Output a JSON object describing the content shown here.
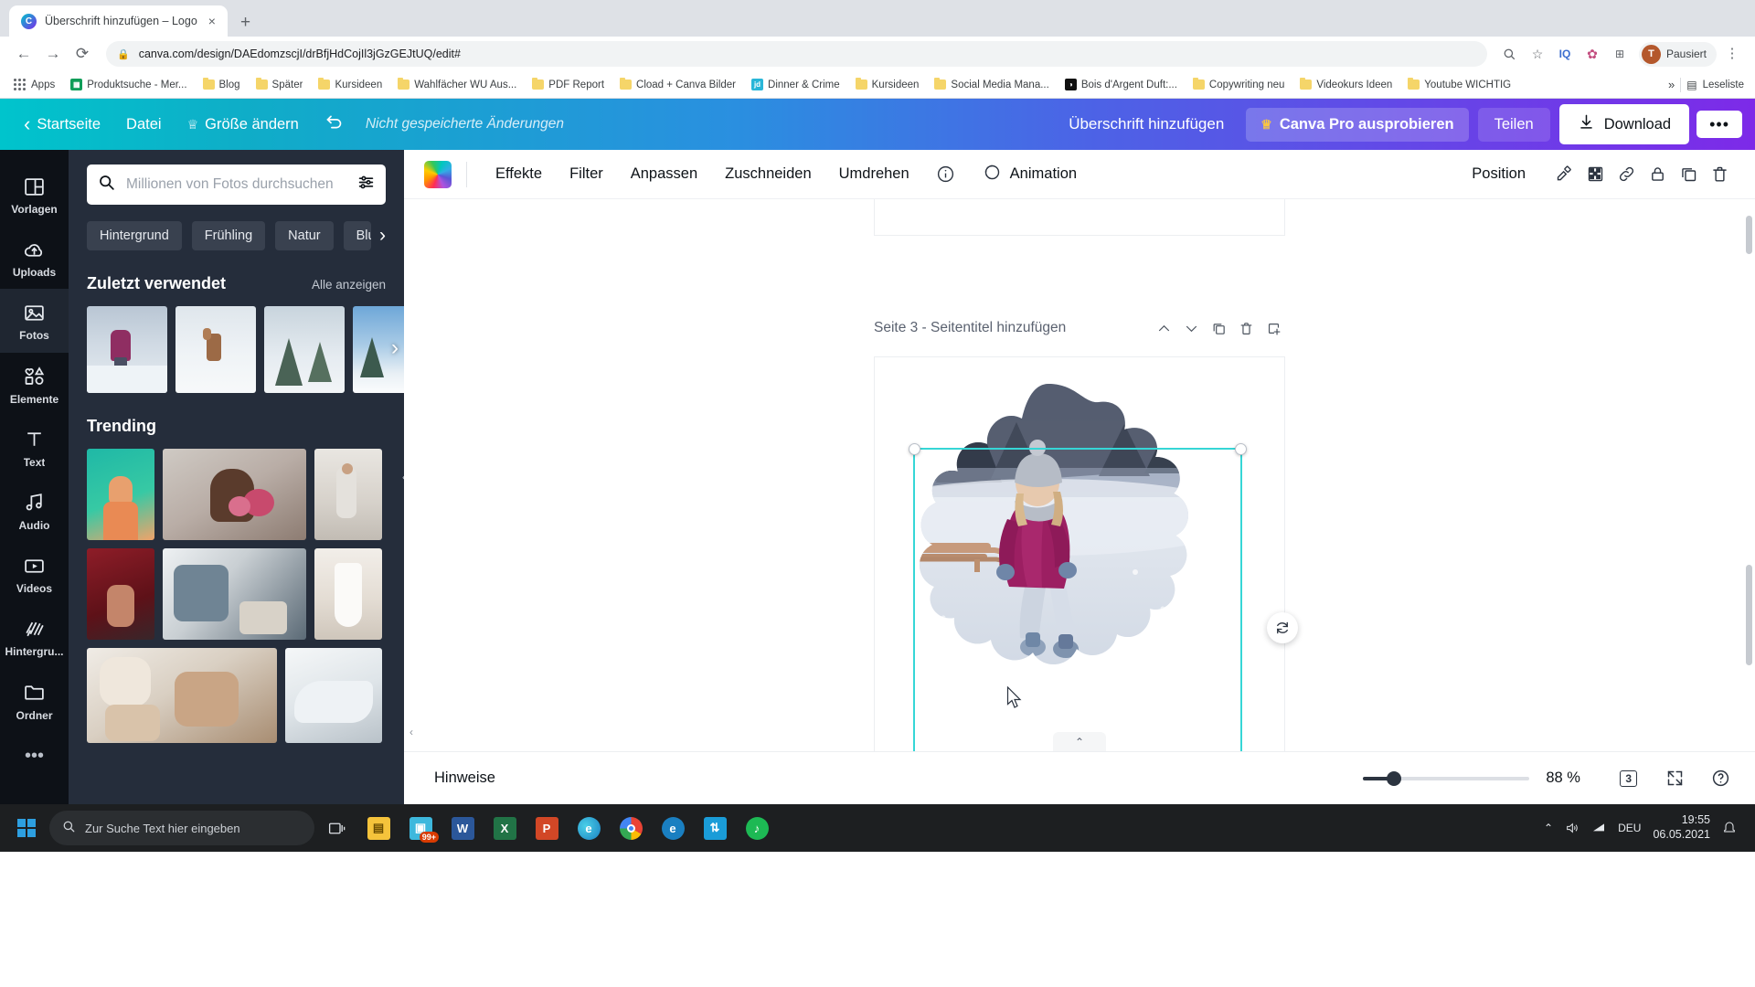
{
  "browser": {
    "tab": {
      "title": "Überschrift hinzufügen – Logo",
      "favicon": "canva-icon",
      "close": "×"
    },
    "new_tab": "+",
    "nav": {
      "back": "←",
      "forward": "→",
      "reload": "⟳"
    },
    "url": "canva.com/design/DAEdomzscjI/drBfjHdCojIl3jGzGEJtUQ/edit#",
    "lock": "lock-icon",
    "omni_icons": [
      "zoom-icon",
      "star-icon"
    ],
    "profile": {
      "initial": "T",
      "label": "Pausiert"
    },
    "apps_label": "Apps",
    "bookmarks": [
      {
        "label": "Produktsuche - Mer...",
        "icon": "sheets",
        "color": "#0f9d58"
      },
      {
        "label": "Blog",
        "icon": "folder"
      },
      {
        "label": "Später",
        "icon": "folder"
      },
      {
        "label": "Kursideen",
        "icon": "folder"
      },
      {
        "label": "Wahlfächer WU Aus...",
        "icon": "folder"
      },
      {
        "label": "PDF Report",
        "icon": "folder"
      },
      {
        "label": "Cload + Canva Bilder",
        "icon": "folder"
      },
      {
        "label": "Dinner & Crime",
        "icon": "jd",
        "color": "#29b6d8"
      },
      {
        "label": "Kursideen",
        "icon": "folder"
      },
      {
        "label": "Social Media Mana...",
        "icon": "folder"
      },
      {
        "label": "Bois d'Argent Duft:...",
        "icon": "dark",
        "color": "#111111"
      },
      {
        "label": "Copywriting neu",
        "icon": "folder"
      },
      {
        "label": "Videokurs Ideen",
        "icon": "folder"
      },
      {
        "label": "Youtube WICHTIG",
        "icon": "folder"
      }
    ],
    "overflow": "»",
    "reading_list": "Leseliste"
  },
  "canva_header": {
    "back": "‹",
    "home": "Startseite",
    "file": "Datei",
    "resize": "Größe ändern",
    "resize_icon": "crown-icon",
    "undo": "undo-icon",
    "unsaved": "Nicht gespeicherte Änderungen",
    "design_title": "Überschrift hinzufügen",
    "pro": "Canva Pro ausprobieren",
    "pro_icon": "crown-icon",
    "share": "Teilen",
    "download": "Download",
    "download_icon": "download-icon",
    "more": "•••"
  },
  "rail": {
    "items": [
      {
        "label": "Vorlagen",
        "icon": "templates-icon",
        "active": false
      },
      {
        "label": "Uploads",
        "icon": "upload-cloud-icon",
        "active": false
      },
      {
        "label": "Fotos",
        "icon": "photo-icon",
        "active": true
      },
      {
        "label": "Elemente",
        "icon": "shapes-icon",
        "active": false
      },
      {
        "label": "Text",
        "icon": "text-icon",
        "active": false
      },
      {
        "label": "Audio",
        "icon": "music-note-icon",
        "active": false
      },
      {
        "label": "Videos",
        "icon": "video-icon",
        "active": false
      },
      {
        "label": "Hintergru...",
        "icon": "background-icon",
        "active": false
      },
      {
        "label": "Ordner",
        "icon": "folder-icon",
        "active": false
      },
      {
        "label": "",
        "icon": "more-dots-icon",
        "active": false
      }
    ]
  },
  "panel": {
    "search": {
      "placeholder": "Millionen von Fotos durchsuchen",
      "value": "",
      "icon": "search-icon",
      "filter_icon": "filter-sliders-icon"
    },
    "tags": [
      "Hintergrund",
      "Frühling",
      "Natur",
      "Blumen"
    ],
    "tags_next": "›",
    "recent": {
      "title": "Zuletzt verwendet",
      "link": "Alle anzeigen",
      "next": "›"
    },
    "trending": {
      "title": "Trending"
    },
    "collapse_icon": "chevron-left-icon"
  },
  "toolbar": {
    "color_swatch": "rainbow-color-icon",
    "items": [
      "Effekte",
      "Filter",
      "Anpassen",
      "Zuschneiden",
      "Umdrehen"
    ],
    "info_icon": "info-icon",
    "animation": "Animation",
    "animation_icon": "animation-icon",
    "position": "Position",
    "icons": [
      "copy-style-icon",
      "transparency-icon",
      "link-icon",
      "lock-icon",
      "duplicate-icon",
      "trash-icon"
    ]
  },
  "canvas": {
    "page_label": "Seite 3 - Seitentitel hinzufügen",
    "page_actions": [
      "move-up-icon",
      "move-down-icon",
      "duplicate-page-icon",
      "delete-page-icon",
      "add-page-icon"
    ],
    "rotate_icon": "rotate-icon",
    "scroll_up_icon": "chevron-up-icon",
    "selection_color": "#36d6d6"
  },
  "status": {
    "notes": "Hinweise",
    "zoom_percent": "88 %",
    "zoom_value": 88,
    "page_count": "3",
    "page_icon": "pages-icon",
    "fullscreen_icon": "expand-icon",
    "help_icon": "help-icon"
  },
  "taskbar": {
    "start_icon": "windows-icon",
    "search_placeholder": "Zur Suche Text hier eingeben",
    "search_icon": "search-icon",
    "items": [
      {
        "name": "task-view-icon",
        "glyph": "❏",
        "color": "transparent"
      },
      {
        "name": "file-explorer-icon",
        "glyph": "▤",
        "color": "#f5c33b"
      },
      {
        "name": "store-icon",
        "glyph": "99",
        "color": "#3db8dd",
        "badge": "99+"
      },
      {
        "name": "word-icon",
        "glyph": "W",
        "color": "#2b579a"
      },
      {
        "name": "excel-icon",
        "glyph": "X",
        "color": "#217346"
      },
      {
        "name": "powerpoint-icon",
        "glyph": "P",
        "color": "#d24726"
      },
      {
        "name": "edge-icon",
        "glyph": "e",
        "color": "#2f8fd0"
      },
      {
        "name": "chrome-icon",
        "glyph": "◉",
        "color": "#4285f4"
      },
      {
        "name": "edge2-icon",
        "glyph": "e",
        "color": "#1a7fc1"
      },
      {
        "name": "sync-icon",
        "glyph": "⇅",
        "color": "#1a9cd8"
      },
      {
        "name": "spotify-icon",
        "glyph": "♪",
        "color": "#1db954"
      }
    ],
    "tray": {
      "chevron": "⌃",
      "volume_icon": "volume-icon",
      "network_icon": "network-icon",
      "lang": "DEU",
      "time": "19:55",
      "date": "06.05.2021",
      "notification_icon": "notification-icon"
    }
  }
}
